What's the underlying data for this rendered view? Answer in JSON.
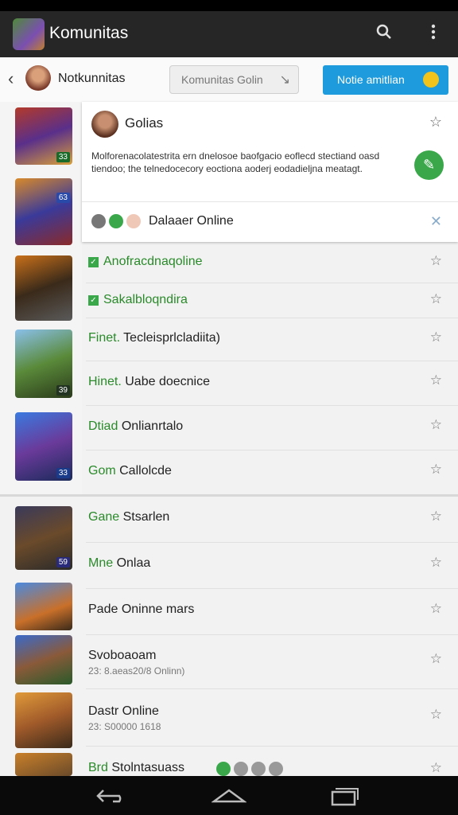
{
  "app": {
    "title": "Komunitas"
  },
  "subheader": {
    "title": "Notkunnitas",
    "search_placeholder": "Komunitas Golin",
    "notif_label": "Notie amitlian"
  },
  "card": {
    "name": "Golias",
    "description": "Molforenacolatestrita ern dnelosoe baofgacio eoflecd stectiand oasd tiendoo; the telnedocecory eoctiona aoderj eodadieljna meatagt.",
    "online_label": "Dalaaer Online"
  },
  "rows": [
    {
      "prefix": "",
      "label": "Anofracdnaqoline",
      "check": true,
      "green": true
    },
    {
      "prefix": "",
      "label": "Sakalbloqndira",
      "check": true,
      "green": true
    },
    {
      "prefix": "Finet.",
      "label": "Tecleisprlcladiita)"
    },
    {
      "prefix": "Hinet.",
      "label": "Uabe doecnice"
    },
    {
      "prefix": "Dtiad",
      "label": "Onlianrtalo"
    },
    {
      "prefix": "Gom",
      "label": "Callolcde"
    },
    {
      "prefix": "Gane",
      "label": "Stsarlen"
    },
    {
      "prefix": "Mne",
      "label": "Onlaa"
    },
    {
      "prefix": "",
      "label": "Pade Oninne mars"
    },
    {
      "prefix": "",
      "label": "Svoboaoam",
      "sub": "23: 8.aeas20/8 Onlinn)"
    },
    {
      "prefix": "",
      "label": "Dastr Online",
      "sub": "23: S00000 1618"
    },
    {
      "prefix": "Brd",
      "label": "Stolntasuass"
    }
  ],
  "thumb_badges": [
    "33",
    "63",
    "",
    "39",
    "33",
    "59"
  ]
}
